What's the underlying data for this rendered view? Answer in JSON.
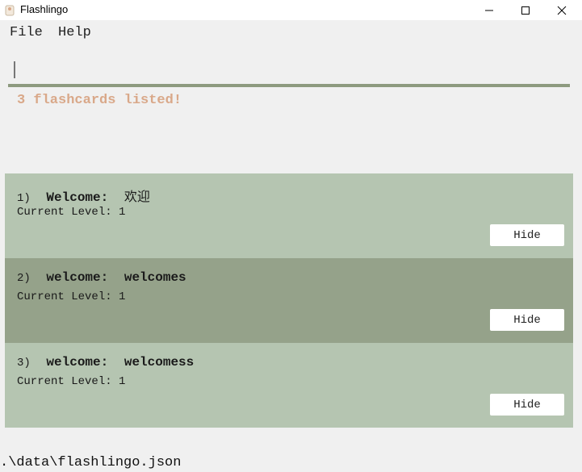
{
  "window": {
    "title": "Flashlingo"
  },
  "menu": {
    "items": [
      "File",
      "Help"
    ]
  },
  "command": {
    "value": "",
    "placeholder": ""
  },
  "result": {
    "text": "3 flashcards listed!"
  },
  "flashcards": [
    {
      "index": "1)",
      "word": "Welcome:",
      "translation": "欢迎",
      "level_text": "Current Level: 1",
      "button": "Hide"
    },
    {
      "index": "2)",
      "word": "welcome:",
      "translation": "welcomes",
      "level_text": "Current Level: 1",
      "button": "Hide"
    },
    {
      "index": "3)",
      "word": "welcome:",
      "translation": "welcomess",
      "level_text": "Current Level: 1",
      "button": "Hide"
    }
  ],
  "status": {
    "path": ".\\data\\flashlingo.json"
  },
  "colors": {
    "card_light": "#b5c5b1",
    "card_selected": "#95a28a",
    "result_text": "#d9a889",
    "command_underline": "#8d9a7f"
  }
}
